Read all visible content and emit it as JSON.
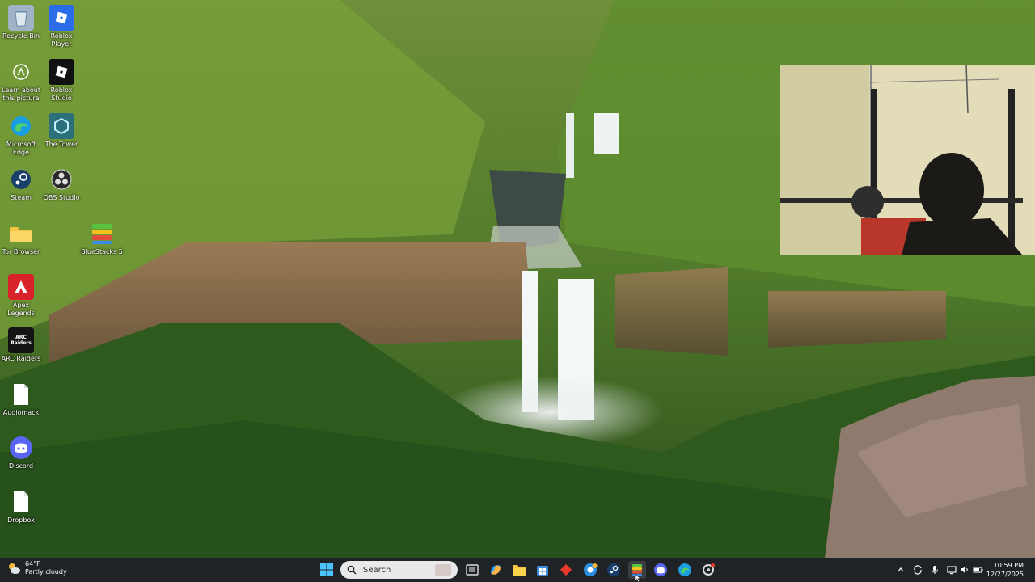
{
  "desktop": {
    "icons": [
      {
        "label": "Recycle Bin",
        "icon": "recycle-bin-icon"
      },
      {
        "label": "Roblox Player",
        "icon": "roblox-player-icon"
      },
      {
        "label": "Learn about this picture",
        "icon": "learn-picture-icon"
      },
      {
        "label": "Roblox Studio",
        "icon": "roblox-studio-icon"
      },
      {
        "label": "Microsoft Edge",
        "icon": "edge-icon"
      },
      {
        "label": "The Tower",
        "icon": "the-tower-icon"
      },
      {
        "label": "Steam",
        "icon": "steam-icon"
      },
      {
        "label": "OBS Studio",
        "icon": "obs-icon"
      },
      {
        "label": "Tor Browser",
        "icon": "folder-icon"
      },
      {
        "label": "BlueStacks 5",
        "icon": "bluestacks-icon"
      },
      {
        "label": "Apex Legends",
        "icon": "apex-icon"
      },
      {
        "label": "ARC Raiders",
        "icon": "arc-raiders-icon"
      },
      {
        "label": "Audiomack",
        "icon": "file-icon"
      },
      {
        "label": "Discord",
        "icon": "discord-icon"
      },
      {
        "label": "Dropbox",
        "icon": "file-icon"
      }
    ],
    "arc_badge": "ARC Raiders"
  },
  "taskbar": {
    "weather": {
      "temp": "64°F",
      "condition": "Partly cloudy"
    },
    "search_placeholder": "Search",
    "clock": {
      "time": "10:59 PM",
      "date": "12/27/2025"
    },
    "pinned": [
      "start-icon",
      "task-view-icon",
      "copilot-icon",
      "file-explorer-icon",
      "store-icon",
      "roblox-taskbar-icon",
      "chrome-icon",
      "steam-taskbar-icon",
      "bluestacks-taskbar-icon",
      "discord-taskbar-icon",
      "edge-taskbar-icon",
      "settings-taskbar-icon"
    ]
  },
  "colors": {
    "taskbar": "#1f2326",
    "accent": "#4cc2ff"
  }
}
